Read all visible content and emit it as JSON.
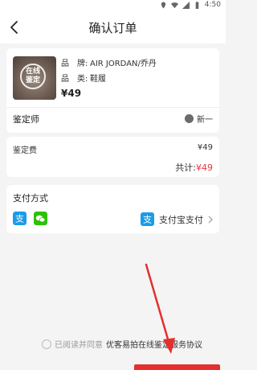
{
  "status_bar": {
    "time": "4:50"
  },
  "header": {
    "title": "确认订单"
  },
  "product": {
    "thumbnail_text": "在线\n鉴定",
    "brand_label": "品　牌:",
    "brand_value": "AIR JORDAN/乔丹",
    "category_label": "品　类:",
    "category_value": "鞋履",
    "price": "¥49"
  },
  "appraiser": {
    "label": "鉴定师",
    "name": "新一"
  },
  "fees": {
    "fee_label": "鉴定费",
    "fee_value": "¥49",
    "total_label": "共计:",
    "total_value": "¥49"
  },
  "payment": {
    "title": "支付方式",
    "selected": "支付宝支付",
    "icons": [
      "alipay-icon",
      "wechat-pay-icon"
    ]
  },
  "agreement": {
    "prefix": "已阅读并同意",
    "link": "优客易拍在线鉴定服务协议"
  },
  "colors": {
    "accent": "#e8343a",
    "alipay": "#1a9ce8",
    "wechat": "#2dc100"
  }
}
